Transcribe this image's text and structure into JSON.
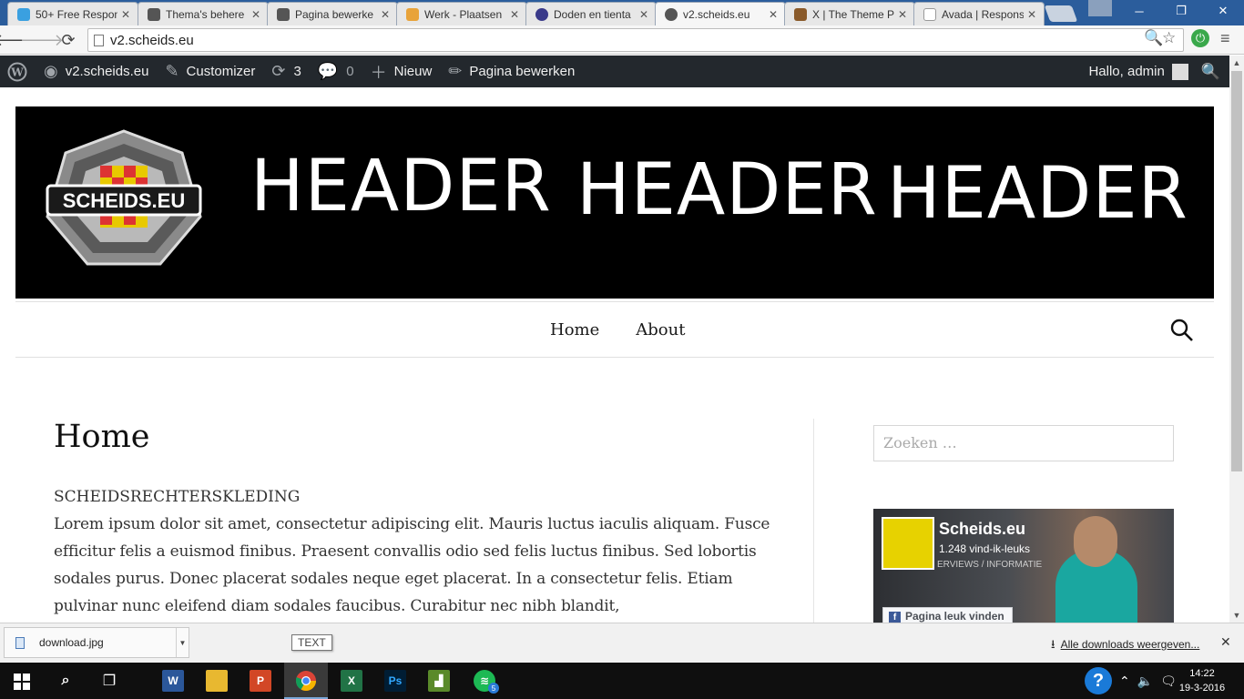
{
  "browser": {
    "tabs": [
      {
        "title": "50+ Free Respon",
        "active": false,
        "fav_color": "#3aa0e0"
      },
      {
        "title": "Thema's behere",
        "active": false,
        "fav_color": "#555555"
      },
      {
        "title": "Pagina bewerke",
        "active": false,
        "fav_color": "#555555"
      },
      {
        "title": "Werk - Plaatsen",
        "active": false,
        "fav_color": "#e8a33a"
      },
      {
        "title": "Doden en tienta",
        "active": false,
        "fav_color": "#3a3a8a"
      },
      {
        "title": "v2.scheids.eu",
        "active": true,
        "fav_color": "#555555"
      },
      {
        "title": "X | The Theme P",
        "active": false,
        "fav_color": "#8a5a2a"
      },
      {
        "title": "Avada | Respons",
        "active": false,
        "fav_color": "#dddddd"
      }
    ],
    "url": "v2.scheids.eu"
  },
  "adminbar": {
    "site": "v2.scheids.eu",
    "customizer": "Customizer",
    "updates_count": "3",
    "comments_count": "0",
    "new": "Nieuw",
    "edit_page": "Pagina bewerken",
    "greeting": "Hallo, admin"
  },
  "header": {
    "logo_text": "SCHEIDS.EU",
    "texts": [
      "HEADER",
      "HEADER",
      "HEADER"
    ]
  },
  "nav": {
    "items": [
      "Home",
      "About"
    ]
  },
  "content": {
    "title": "Home",
    "kicker": "SCHEIDSRECHTERSKLEDING",
    "paragraph": "Lorem ipsum dolor sit amet, consectetur adipiscing elit. Mauris luctus iaculis aliquam. Fusce efficitur felis a euismod finibus. Praesent convallis odio sed felis luctus finibus. Sed lobortis sodales purus. Donec placerat sodales neque eget placerat. In a consectetur felis. Etiam pulvinar nunc eleifend diam sodales faucibus. Curabitur nec nibh blandit,"
  },
  "sidebar": {
    "search_placeholder": "Zoeken …",
    "fb": {
      "name": "Scheids.eu",
      "likes": "1.248 vind-ik-leuks",
      "sub": "ERVIEWS / INFORMATIE",
      "like_button": "Pagina leuk vinden"
    }
  },
  "downloads": {
    "file": "download.jpg",
    "tooltip": "TEXT",
    "show_all": "Alle downloads weergeven..."
  },
  "taskbar": {
    "time": "14:22",
    "date": "19-3-2016",
    "spotify_badge": "5"
  },
  "colors": {
    "adminbar": "#23282d",
    "chrome_frame": "#2b5d9c",
    "header_bg": "#000000"
  }
}
